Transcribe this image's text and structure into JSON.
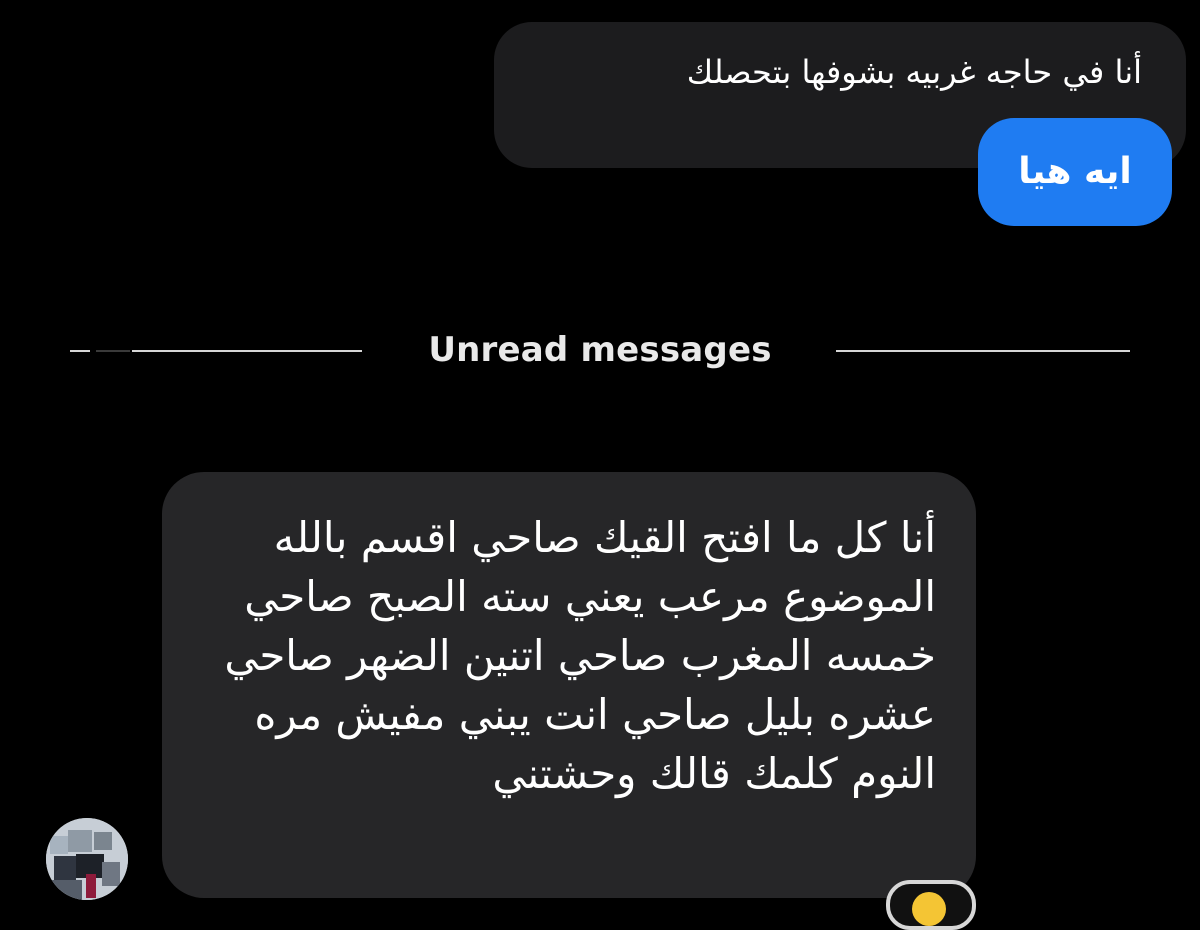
{
  "chat": {
    "divider_label": "Unread messages",
    "messages": [
      {
        "sender": "other",
        "text": "أنا في حاجه غربيه بشوفها بتحصلك"
      },
      {
        "sender": "me",
        "text": "ايه هيا"
      },
      {
        "sender": "other",
        "text": "أنا كل ما افتح القيك صاحي اقسم بالله الموضوع مرعب يعني سته الصبح صاحي خمسه المغرب صاحي اتنين الضهر صاحي عشره بليل صاحي انت يبني مفيش مره النوم كلمك قالك وحشتني"
      }
    ]
  },
  "colors": {
    "background": "#000000",
    "incoming_bubble_top": "#1c1c1e",
    "incoming_bubble_main": "#262628",
    "outgoing_bubble": "#1f7cf2",
    "divider_text": "#e9e9e9"
  },
  "icons": {
    "avatar": "profile-avatar",
    "reaction": "emoji-reaction-icon"
  }
}
